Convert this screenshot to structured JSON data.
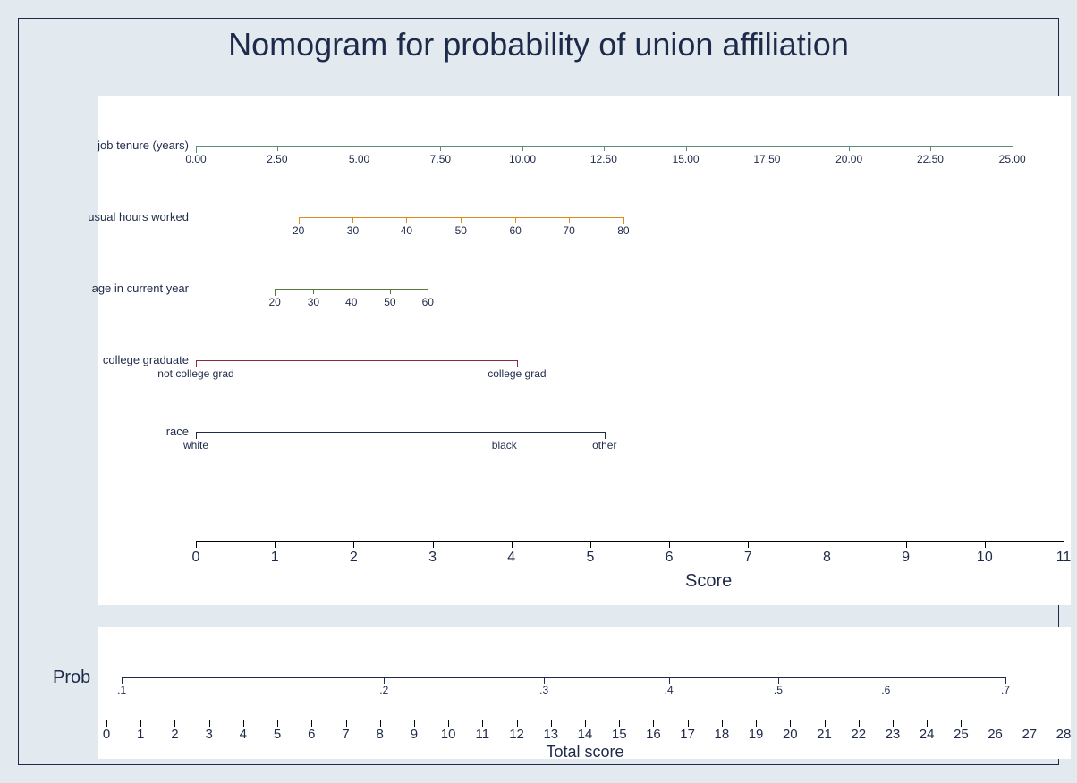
{
  "title": "Nomogram for probability of union affiliation",
  "score_axis": {
    "label": "Score",
    "min": 0,
    "max": 11,
    "ticks": [
      0,
      1,
      2,
      3,
      4,
      5,
      6,
      7,
      8,
      9,
      10,
      11
    ]
  },
  "predictors": [
    {
      "name": "job tenure (years)",
      "color": "#5a8f7b",
      "score_start": 0,
      "score_end": 10.35,
      "ticks": [
        {
          "label": "0.00",
          "score": 0.0
        },
        {
          "label": "2.50",
          "score": 1.03
        },
        {
          "label": "5.00",
          "score": 2.07
        },
        {
          "label": "7.50",
          "score": 3.1
        },
        {
          "label": "10.00",
          "score": 4.14
        },
        {
          "label": "12.50",
          "score": 5.17
        },
        {
          "label": "15.00",
          "score": 6.21
        },
        {
          "label": "17.50",
          "score": 7.24
        },
        {
          "label": "20.00",
          "score": 8.28
        },
        {
          "label": "22.50",
          "score": 9.31
        },
        {
          "label": "25.00",
          "score": 10.35
        }
      ]
    },
    {
      "name": "usual hours worked",
      "color": "#d98c1a",
      "score_start": 1.3,
      "score_end": 5.42,
      "ticks": [
        {
          "label": "20",
          "score": 1.3
        },
        {
          "label": "30",
          "score": 1.99
        },
        {
          "label": "40",
          "score": 2.67
        },
        {
          "label": "50",
          "score": 3.36
        },
        {
          "label": "60",
          "score": 4.05
        },
        {
          "label": "70",
          "score": 4.73
        },
        {
          "label": "80",
          "score": 5.42
        }
      ]
    },
    {
      "name": "age in current year",
      "color": "#5a7a3a",
      "score_start": 1.0,
      "score_end": 2.94,
      "ticks": [
        {
          "label": "20",
          "score": 1.0
        },
        {
          "label": "30",
          "score": 1.49
        },
        {
          "label": "40",
          "score": 1.97
        },
        {
          "label": "50",
          "score": 2.46
        },
        {
          "label": "60",
          "score": 2.94
        }
      ]
    },
    {
      "name": "college graduate",
      "color": "#8a2a3a",
      "score_start": 0.0,
      "score_end": 4.07,
      "ticks": [
        {
          "label": "not college grad",
          "score": 0.0
        },
        {
          "label": "college grad",
          "score": 4.07
        }
      ]
    },
    {
      "name": "race",
      "color": "#1e2a4a",
      "score_start": 0.0,
      "score_end": 5.18,
      "ticks": [
        {
          "label": "white",
          "score": 0.0
        },
        {
          "label": "black",
          "score": 3.91
        },
        {
          "label": "other",
          "score": 5.18
        }
      ]
    }
  ],
  "total_score_axis": {
    "label": "Total score",
    "min": 0,
    "max": 28,
    "ticks": [
      0,
      1,
      2,
      3,
      4,
      5,
      6,
      7,
      8,
      9,
      10,
      11,
      12,
      13,
      14,
      15,
      16,
      17,
      18,
      19,
      20,
      21,
      22,
      23,
      24,
      25,
      26,
      27,
      28
    ]
  },
  "probability": {
    "label": "Prob",
    "color": "#1e2a4a",
    "ticks": [
      {
        "label": ".1",
        "total": 0.45
      },
      {
        "label": ".2",
        "total": 8.12
      },
      {
        "label": ".3",
        "total": 12.8
      },
      {
        "label": ".4",
        "total": 16.45
      },
      {
        "label": ".5",
        "total": 19.65
      },
      {
        "label": ".6",
        "total": 22.8
      },
      {
        "label": ".7",
        "total": 26.3
      }
    ]
  },
  "chart_data": {
    "type": "nomogram",
    "title": "Nomogram for probability of union affiliation",
    "score_axis": {
      "label": "Score",
      "range": [
        0,
        11
      ]
    },
    "predictors": [
      {
        "name": "job tenure (years)",
        "values": [
          0,
          2.5,
          5,
          7.5,
          10,
          12.5,
          15,
          17.5,
          20,
          22.5,
          25
        ],
        "score_range": [
          0,
          10.35
        ]
      },
      {
        "name": "usual hours worked",
        "values": [
          20,
          30,
          40,
          50,
          60,
          70,
          80
        ],
        "score_range": [
          1.3,
          5.42
        ]
      },
      {
        "name": "age in current year",
        "values": [
          20,
          30,
          40,
          50,
          60
        ],
        "score_range": [
          1.0,
          2.94
        ]
      },
      {
        "name": "college graduate",
        "values": [
          "not college grad",
          "college grad"
        ],
        "score_range": [
          0,
          4.07
        ]
      },
      {
        "name": "race",
        "values": [
          "white",
          "black",
          "other"
        ],
        "score_positions": [
          0,
          3.91,
          5.18
        ]
      }
    ],
    "total_score_axis": {
      "label": "Total score",
      "range": [
        0,
        28
      ]
    },
    "probability_scale": {
      "label": "Prob",
      "prob": [
        0.1,
        0.2,
        0.3,
        0.4,
        0.5,
        0.6,
        0.7
      ],
      "total_score": [
        0.45,
        8.12,
        12.8,
        16.45,
        19.65,
        22.8,
        26.3
      ]
    }
  }
}
